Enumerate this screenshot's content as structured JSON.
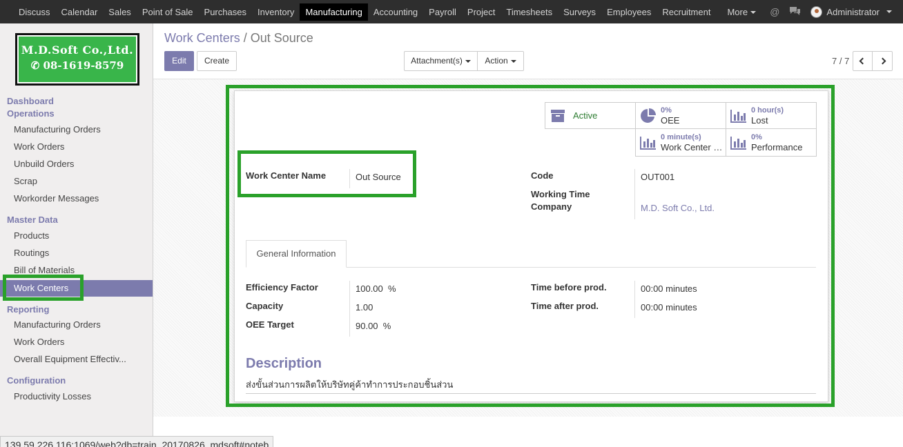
{
  "topnav": {
    "items": [
      "Discuss",
      "Calendar",
      "Sales",
      "Point of Sale",
      "Purchases",
      "Inventory",
      "Manufacturing",
      "Accounting",
      "Payroll",
      "Project",
      "Timesheets",
      "Surveys",
      "Employees",
      "Recruitment",
      "More"
    ],
    "active": "Manufacturing",
    "user": "Administrator",
    "mention_icon": "@"
  },
  "logo": {
    "line1": "M.D.Soft Co.,Ltd.",
    "line2": "✆ 08-1619-8579"
  },
  "sidebar": {
    "dashboard": "Dashboard",
    "operations": "Operations",
    "operations_items": [
      "Manufacturing Orders",
      "Work Orders",
      "Unbuild Orders",
      "Scrap",
      "Workorder Messages"
    ],
    "master_data": "Master Data",
    "master_items": [
      "Products",
      "Routings",
      "Bill of Materials",
      "Work Centers"
    ],
    "reporting": "Reporting",
    "reporting_items": [
      "Manufacturing Orders",
      "Work Orders",
      "Overall Equipment Effectiv..."
    ],
    "configuration": "Configuration",
    "configuration_items": [
      "Productivity Losses"
    ]
  },
  "breadcrumb": {
    "parent": "Work Centers",
    "separator": "/",
    "current": "Out Source"
  },
  "buttons": {
    "edit": "Edit",
    "create": "Create",
    "attachments": "Attachment(s)",
    "action": "Action"
  },
  "pager": {
    "text": "7 / 7"
  },
  "stats": {
    "active": "Active",
    "oee_value": "0%",
    "oee_label": "OEE",
    "lost_value": "0 hour(s)",
    "lost_label": "Lost",
    "load_value": "0 minute(s)",
    "load_label": "Work Center Load",
    "perf_value": "0%",
    "perf_label": "Performance"
  },
  "form": {
    "name_label": "Work Center Name",
    "name_value": "Out Source",
    "code_label": "Code",
    "code_value": "OUT001",
    "wt_label": "Working Time",
    "company_label": "Company",
    "company_value": "M.D. Soft Co., Ltd."
  },
  "tab": {
    "general": "General Information"
  },
  "general": {
    "eff_label": "Efficiency Factor",
    "eff_value": "100.00",
    "eff_unit": "%",
    "cap_label": "Capacity",
    "cap_value": "1.00",
    "oee_label": "OEE Target",
    "oee_value": "90.00",
    "oee_unit": "%",
    "tbp_label": "Time before prod.",
    "tbp_value": "00:00 minutes",
    "tap_label": "Time after prod.",
    "tap_value": "00:00 minutes"
  },
  "description": {
    "title": "Description",
    "text": "ส่งขั้นส่วนการผลิตให้บริษัทคู่ค้าทำการประกอบชิ้นส่วน"
  },
  "statusbar": {
    "url": "139.59.226.116:1069/web?db=train_20170826_mdsoft#noteb"
  },
  "colors": {
    "accent": "#7c7bad",
    "highlight": "#2aa12a",
    "topbar": "#2e2e2e",
    "active_green": "#2e7d32"
  }
}
